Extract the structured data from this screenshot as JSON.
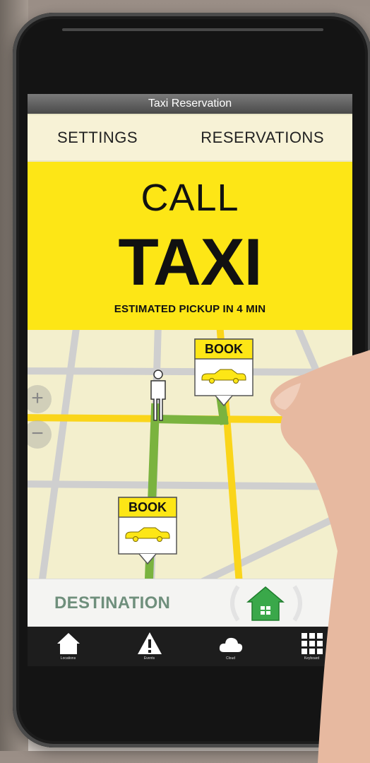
{
  "app": {
    "title": "Taxi Reservation"
  },
  "tabs": [
    {
      "label": "SETTINGS"
    },
    {
      "label": "RESERVATIONS"
    }
  ],
  "hero": {
    "line1": "CALL",
    "line2": "TAXI",
    "eta_text": "ESTIMATED PICKUP IN 4 MIN"
  },
  "map": {
    "zoom_in": "+",
    "zoom_out": "−",
    "book_markers": [
      {
        "label": "BOOK"
      },
      {
        "label": "BOOK"
      }
    ]
  },
  "destination": {
    "label": "DESTINATION"
  },
  "bottom_nav": [
    {
      "label": "Locations",
      "icon": "house-icon"
    },
    {
      "label": "Events",
      "icon": "warning-icon"
    },
    {
      "label": "Cloud",
      "icon": "cloud-icon"
    },
    {
      "label": "Keyboard",
      "icon": "keypad-icon"
    }
  ],
  "colors": {
    "accent_yellow": "#fde616",
    "route_green": "#7ab33f",
    "home_green": "#3aa84a"
  }
}
